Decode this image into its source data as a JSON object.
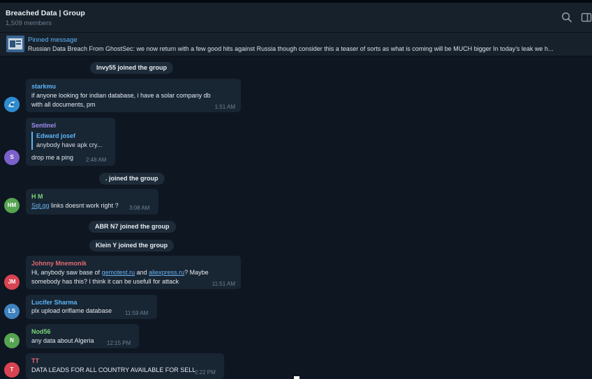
{
  "header": {
    "title": "Breached Data | Group",
    "members": "1,509 members"
  },
  "pinned": {
    "title": "Pinned message",
    "text": "Russian Data Breach  From GhostSec: we now return with a few good hits against Russia though consider this a teaser of sorts as what is coming will be MUCH bigger  In today's leak we h..."
  },
  "services": {
    "s1": "Invy55 joined the group",
    "s2": ". joined the group",
    "s3": "ABR N7 joined the group",
    "s4": "Klein Y joined the group"
  },
  "messages": {
    "m1": {
      "sender": "starkmu",
      "color": "#5eb5f7",
      "line1": "if anyone looking for indian database, i have a solar company db",
      "line2": "with all documents, pm",
      "time": "1:51 AM"
    },
    "m2": {
      "sender": "Sentinel",
      "avatar": "S",
      "avatar_color": "#7b61c9",
      "color": "#a08ef0",
      "reply_name": "Edward josef",
      "reply_text": "anybody have apk cry...",
      "line1": "drop me a ping",
      "time": "2:48 AM"
    },
    "m3": {
      "sender": "H M",
      "avatar": "HM",
      "avatar_color": "#56a352",
      "color": "#7bd77a",
      "link": "Sql.gg",
      "line1": " links doesnt work right ?",
      "time": "3:08 AM"
    },
    "m4": {
      "sender": "Johnny Mnemonik",
      "avatar": "JM",
      "avatar_color": "#d94452",
      "color": "#e26a73",
      "line1a": "Hi, anybody saw base of ",
      "link1": "gemotest.ru",
      "line1b": " and ",
      "link2": "aliexpress.ru",
      "line1c": "? Maybe",
      "line2": "somebody has this? I think it can be usefull for attack",
      "time": "11:51 AM"
    },
    "m5": {
      "sender": "Lucifer Sharma",
      "avatar": "LS",
      "avatar_color": "#3f82c1",
      "color": "#5eb5f7",
      "line1": "plx upload oriflame database",
      "time": "11:59 AM"
    },
    "m6": {
      "sender": "Nod56",
      "avatar": "N",
      "avatar_color": "#56a352",
      "color": "#7bd77a",
      "line1": "any data  about Algeria",
      "time": "12:15 PM"
    },
    "m7": {
      "sender": "TT",
      "avatar": "T",
      "avatar_color": "#d94452",
      "color": "#e26a73",
      "line1": "DATA LEADS FOR ALL COUNTRY AVAILABLE FOR SELL",
      "time": "2:22 PM"
    }
  },
  "icons": {
    "search": "search-icon",
    "sidebar": "sidebar-toggle-icon"
  }
}
